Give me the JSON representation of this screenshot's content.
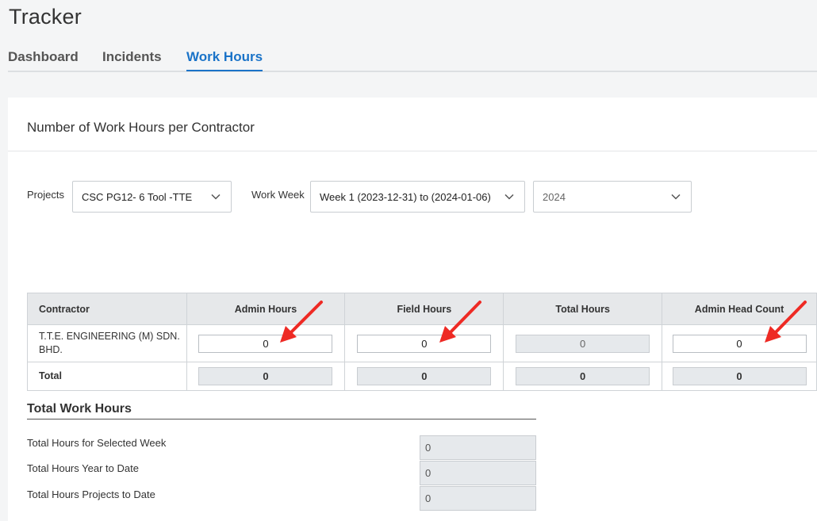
{
  "app": {
    "title": "Tracker"
  },
  "tabs": [
    {
      "label": "Dashboard",
      "active": false
    },
    {
      "label": "Incidents",
      "active": false
    },
    {
      "label": "Work Hours",
      "active": true
    }
  ],
  "panel": {
    "title": "Number of Work Hours per Contractor"
  },
  "filters": {
    "projects_label": "Projects",
    "projects_value": "CSC PG12- 6 Tool -TTE",
    "work_week_label": "Work Week",
    "work_week_value": "Week 1 (2023-12-31) to (2024-01-06)",
    "year_value": "2024"
  },
  "table": {
    "headers": [
      "Contractor",
      "Admin Hours",
      "Field Hours",
      "Total Hours",
      "Admin Head Count"
    ],
    "rows": [
      {
        "contractor_line1": "T.T.E. ENGINEERING (M) SDN.",
        "contractor_line2": "BHD.",
        "admin_hours": "0",
        "field_hours": "0",
        "total_hours": "0",
        "admin_head_count": "0"
      }
    ],
    "total": {
      "label": "Total",
      "admin_hours": "0",
      "field_hours": "0",
      "total_hours": "0",
      "admin_head_count": "0"
    }
  },
  "summary": {
    "title": "Total Work Hours",
    "items": [
      {
        "label": "Total Hours for Selected Week",
        "value": "0"
      },
      {
        "label": "Total Hours Year to Date",
        "value": "0"
      },
      {
        "label": "Total Hours Projects to Date",
        "value": "0"
      }
    ]
  },
  "annotation": {
    "arrow_color": "#ee2a24"
  }
}
